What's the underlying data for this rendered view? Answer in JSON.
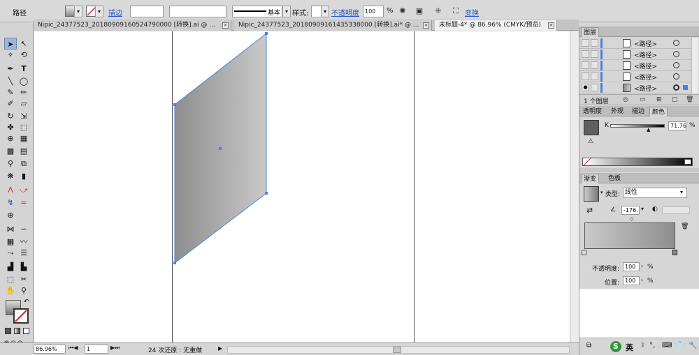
{
  "control_bar": {
    "object_type": "路径",
    "stroke_link": "描边",
    "stroke_profile": "基本",
    "style_label": "样式:",
    "opacity_link": "不透明度",
    "opacity_value": "100",
    "percent": "%",
    "transform_link": "变换"
  },
  "tabs": [
    {
      "label": "Nipic_24377523_20180909160524790000 [转换].ai @ ...",
      "active": false
    },
    {
      "label": "Nipic_24377523_20180909161435338000 [转换].ai* @ ...",
      "active": false
    },
    {
      "label": "未标题-4* @ 86.96% (CMYK/预览)",
      "active": true
    }
  ],
  "status_bar": {
    "zoom": "86.96%",
    "artboard": "1",
    "undo_status": "24 次还原 : 无重做"
  },
  "layers_panel": {
    "title": "图层",
    "layers": [
      {
        "name": "<路径>"
      },
      {
        "name": "<路径>"
      },
      {
        "name": "<路径>"
      },
      {
        "name": "<路径>"
      },
      {
        "name": "<路径>"
      }
    ],
    "count": "1 个图层"
  },
  "color_panel": {
    "tabs": [
      "透明度",
      "外观",
      "描边",
      "颜色"
    ],
    "active_tab": "颜色",
    "channel_label": "K",
    "k_value": "71.76",
    "percent": "%"
  },
  "gradient_panel": {
    "tabs": [
      "渐变",
      "色板"
    ],
    "active_tab": "渐变",
    "type_label": "类型:",
    "type_value": "线性",
    "angle_value": "-176.",
    "opacity_label": "不透明度:",
    "opacity_value": "100",
    "position_label": "位置:",
    "position_value": "100",
    "percent": "%"
  },
  "taskbar": {
    "ime_label": "英"
  },
  "colors": {
    "selection_blue": "#4f7fe0",
    "shape_light": "#c9c9c9",
    "shape_dark": "#8e8e8e",
    "k_swatch": "#5f5f5f"
  }
}
